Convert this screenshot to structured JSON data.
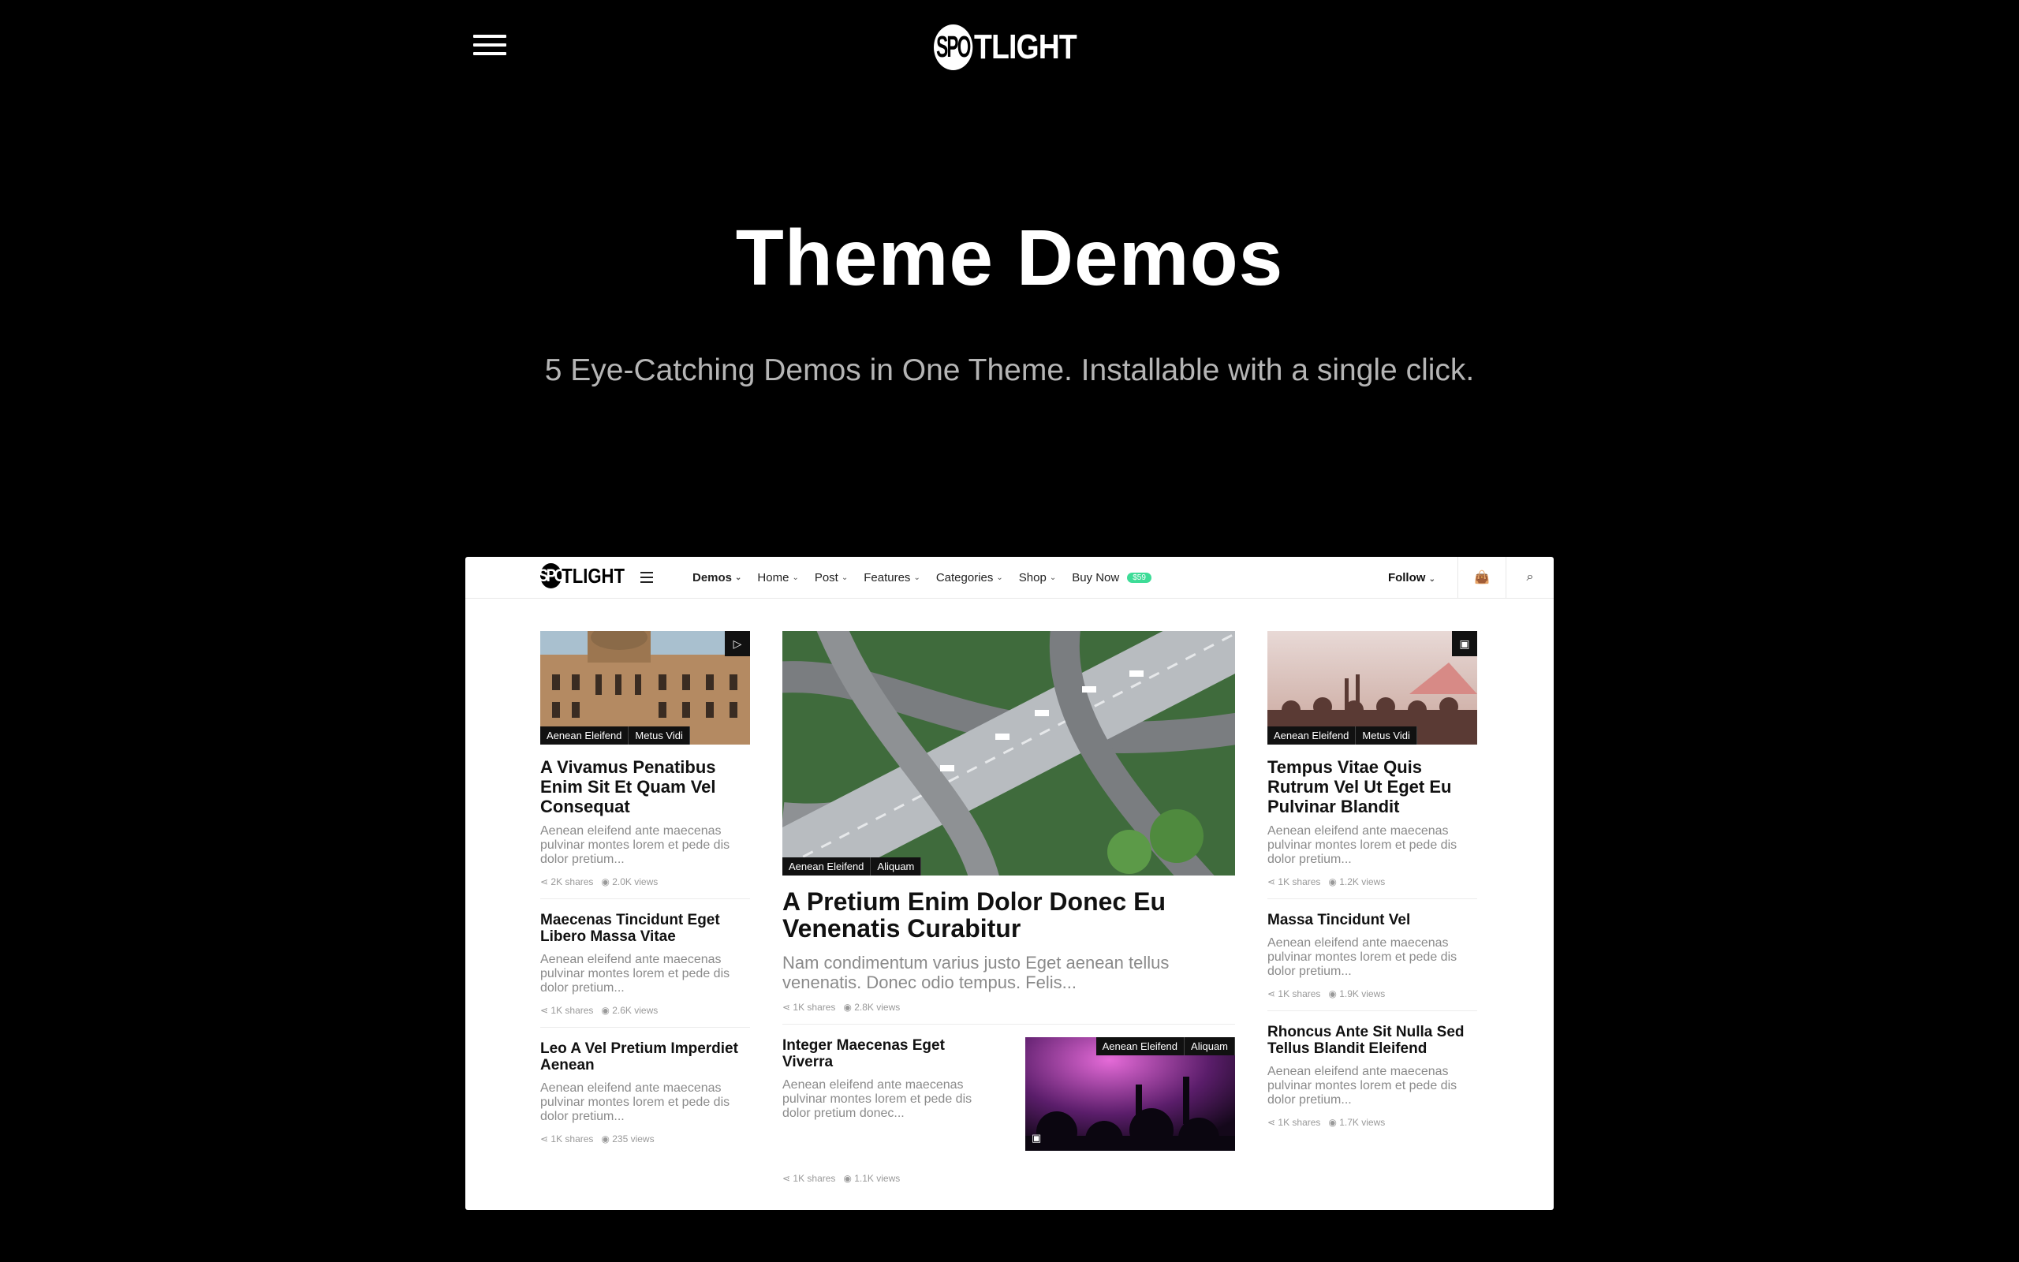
{
  "header": {
    "menu_icon": "hamburger-icon",
    "logo_prefix": "SPO",
    "logo_suffix": "TLIGHT"
  },
  "hero": {
    "title": "Theme Demos",
    "subtitle": "5 Eye-Catching Demos in One Theme. Installable with a single click."
  },
  "preview": {
    "nav": {
      "logo_prefix": "SPO",
      "logo_suffix": "TLIGHT",
      "items": [
        {
          "label": "Demos"
        },
        {
          "label": "Home"
        },
        {
          "label": "Post"
        },
        {
          "label": "Features"
        },
        {
          "label": "Categories"
        },
        {
          "label": "Shop"
        },
        {
          "label": "Buy Now"
        }
      ],
      "buy_badge": "$59",
      "follow": "Follow"
    },
    "left": [
      {
        "tags": [
          "Aenean Eleifend",
          "Metus Vidi"
        ],
        "title": "A Vivamus Penatibus Enim Sit Et Quam Vel Consequat",
        "excerpt": "Aenean eleifend ante maecenas pulvinar montes lorem et pede dis dolor pretium...",
        "shares": "2K shares",
        "views": "2.0K views"
      },
      {
        "title": "Maecenas Tincidunt Eget Libero Massa Vitae",
        "excerpt": "Aenean eleifend ante maecenas pulvinar montes lorem et pede dis dolor pretium...",
        "shares": "1K shares",
        "views": "2.6K views"
      },
      {
        "title": "Leo A Vel Pretium Imperdiet Aenean",
        "excerpt": "Aenean eleifend ante maecenas pulvinar montes lorem et pede dis dolor pretium...",
        "shares": "1K shares",
        "views": "235 views"
      }
    ],
    "center": {
      "tags": [
        "Aenean Eleifend",
        "Aliquam"
      ],
      "title": "A Pretium Enim Dolor Donec Eu Venenatis Curabitur",
      "excerpt": "Nam condimentum varius justo Eget aenean tellus venenatis. Donec odio tempus. Felis...",
      "shares": "1K shares",
      "views": "2.8K views",
      "sub": {
        "title": "Integer Maecenas Eget Viverra",
        "excerpt": "Aenean eleifend ante maecenas pulvinar montes lorem et pede dis dolor pretium donec...",
        "tags": [
          "Aenean Eleifend",
          "Aliquam"
        ],
        "shares": "1K shares",
        "views": "1.1K views"
      }
    },
    "right": [
      {
        "tags": [
          "Aenean Eleifend",
          "Metus Vidi"
        ],
        "title": "Tempus Vitae Quis Rutrum Vel Ut Eget Eu Pulvinar Blandit",
        "excerpt": "Aenean eleifend ante maecenas pulvinar montes lorem et pede dis dolor pretium...",
        "shares": "1K shares",
        "views": "1.2K views"
      },
      {
        "title": "Massa Tincidunt Vel",
        "excerpt": "Aenean eleifend ante maecenas pulvinar montes lorem et pede dis dolor pretium...",
        "shares": "1K shares",
        "views": "1.9K views"
      },
      {
        "title": "Rhoncus Ante Sit Nulla Sed Tellus Blandit Eleifend",
        "excerpt": "Aenean eleifend ante maecenas pulvinar montes lorem et pede dis dolor pretium...",
        "shares": "1K shares",
        "views": "1.7K views"
      }
    ]
  }
}
